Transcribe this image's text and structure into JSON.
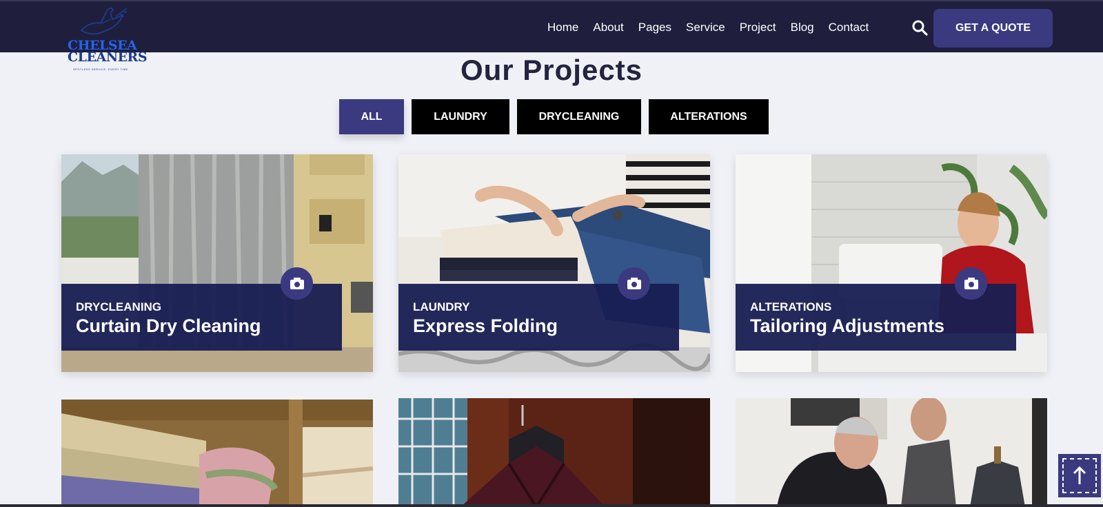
{
  "brand": {
    "line1": "CHELSEA",
    "line2": "CLEANERS",
    "tagline": "SPOTLESS SERVICE, EVERY TIME"
  },
  "nav": {
    "items": [
      "Home",
      "About",
      "Pages",
      "Service",
      "Project",
      "Blog",
      "Contact"
    ],
    "quote_label": "GET A QUOTE"
  },
  "section": {
    "title": "Our Projects"
  },
  "filters": [
    {
      "label": "ALL",
      "active": true
    },
    {
      "label": "LAUNDRY",
      "active": false
    },
    {
      "label": "DRYCLEANING",
      "active": false
    },
    {
      "label": "ALTERATIONS",
      "active": false
    }
  ],
  "projects": [
    {
      "category": "DRYCLEANING",
      "title": "Curtain Dry Cleaning"
    },
    {
      "category": "LAUNDRY",
      "title": "Express Folding"
    },
    {
      "category": "ALTERATIONS",
      "title": "Tailoring Adjustments"
    }
  ],
  "colors": {
    "header": "#1f1f3d",
    "accent": "#3b3a80",
    "overlay": "#181e52",
    "page_bg": "#eff1f7"
  }
}
